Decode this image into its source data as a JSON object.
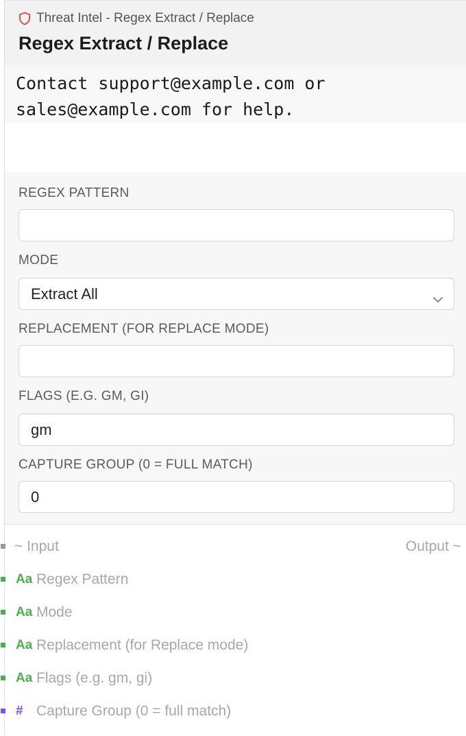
{
  "header": {
    "breadcrumb": "Threat Intel - Regex Extract / Replace",
    "title": "Regex Extract / Replace"
  },
  "preview": {
    "text": "Contact support@example.com or\nsales@example.com for help."
  },
  "fields": {
    "regex_pattern": {
      "label": "REGEX PATTERN",
      "value": ""
    },
    "mode": {
      "label": "MODE",
      "value": "Extract All"
    },
    "replacement": {
      "label": "REPLACEMENT (FOR REPLACE MODE)",
      "value": ""
    },
    "flags": {
      "label": "FLAGS (E.G. GM, GI)",
      "value": "gm"
    },
    "capture_group": {
      "label": "CAPTURE GROUP (0 = FULL MATCH)",
      "value": "0"
    }
  },
  "ports": {
    "input_label": "~ Input",
    "output_label": "Output ~",
    "inputs": [
      {
        "type": "Aa",
        "name": "Regex Pattern",
        "color": "#4caf50"
      },
      {
        "type": "Aa",
        "name": "Mode",
        "color": "#4caf50"
      },
      {
        "type": "Aa",
        "name": "Replacement (for Replace mode)",
        "color": "#4caf50"
      },
      {
        "type": "Aa",
        "name": "Flags (e.g. gm, gi)",
        "color": "#4caf50"
      },
      {
        "type": "#",
        "name": "Capture Group (0 = full match)",
        "color": "#7c4dff"
      }
    ]
  },
  "colors": {
    "shield_icon": "#e05252",
    "string_port": "#4caf50",
    "number_port": "#7c4dff",
    "io_handle": "#9a9a9a"
  }
}
